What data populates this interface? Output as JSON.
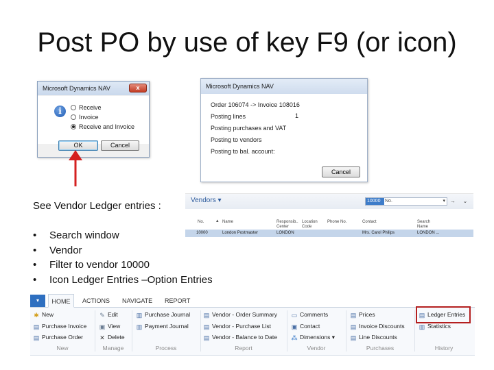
{
  "slide": {
    "title": "Post PO by use of key F9 (or icon)",
    "see_text": "See Vendor Ledger entries :",
    "bullets": [
      "Search window",
      "Vendor",
      "Filter to vendor 10000",
      "Icon Ledger Entries –Option Entries"
    ]
  },
  "dialog_post": {
    "title": "Microsoft Dynamics NAV",
    "close": "x",
    "options": [
      "Receive",
      "Invoice",
      "Receive and Invoice"
    ],
    "selected": "Receive and Invoice",
    "ok": "OK",
    "cancel": "Cancel"
  },
  "dialog_progress": {
    "title": "Microsoft Dynamics NAV",
    "lines": [
      "Order 106074 -> Invoice 108016",
      "Posting lines",
      "Posting purchases and VAT",
      "Posting to vendors",
      "Posting to bal. account:"
    ],
    "posting_lines_value": "1",
    "cancel": "Cancel"
  },
  "vendors_list": {
    "title": "Vendors",
    "search_selected": "10000",
    "search_field": "No.",
    "columns": [
      "No.",
      "Name",
      "Responsib.. Center",
      "Location Code",
      "Phone No.",
      "Contact",
      "Search Name"
    ],
    "row": [
      "10000",
      "London Postmaster",
      "LONDON",
      "",
      "",
      "Mrs. Carol Philips",
      "LONDON ..."
    ]
  },
  "ribbon": {
    "menu": "▾",
    "tabs": [
      "HOME",
      "ACTIONS",
      "NAVIGATE",
      "REPORT"
    ],
    "active_tab": "HOME",
    "new_group": [
      "New",
      "Purchase Invoice",
      "Purchase Order"
    ],
    "manage_group": [
      "Edit",
      "View",
      "Delete"
    ],
    "process_group": [
      "Purchase Journal",
      "Payment Journal"
    ],
    "report_group": [
      "Vendor - Order Summary",
      "Vendor - Purchase List",
      "Vendor - Balance to Date"
    ],
    "vendor_group": [
      "Comments",
      "Contact",
      "Dimensions"
    ],
    "purchases_group": [
      "Prices",
      "Invoice Discounts",
      "Line Discounts"
    ],
    "history_group": [
      "Ledger Entries",
      "Statistics"
    ],
    "group_labels": [
      "New",
      "Manage",
      "Process",
      "Report",
      "Vendor",
      "Purchases",
      "History"
    ]
  },
  "colors": {
    "accent": "#2e6fc0",
    "highlight": "#b41f1f"
  }
}
